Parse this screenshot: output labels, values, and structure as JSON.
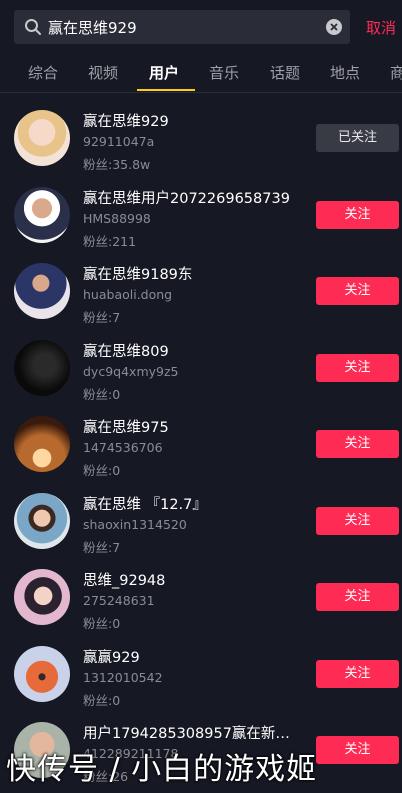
{
  "search": {
    "query": "赢在思维929",
    "cancel_label": "取消"
  },
  "tabs": [
    {
      "label": "综合"
    },
    {
      "label": "视频"
    },
    {
      "label": "用户"
    },
    {
      "label": "音乐"
    },
    {
      "label": "话题"
    },
    {
      "label": "地点"
    },
    {
      "label": "商"
    }
  ],
  "active_tab": "用户",
  "users": [
    {
      "name": "赢在思维929",
      "id": "92911047a",
      "fans": "粉丝:35.8w",
      "button": "已关注"
    },
    {
      "name": "赢在思维用户2072269658739",
      "id": "HMS88998",
      "fans": "粉丝:211",
      "button": "关注"
    },
    {
      "name": "赢在思维9189东",
      "id": "huabaoli.dong",
      "fans": "粉丝:7",
      "button": "关注"
    },
    {
      "name": "赢在思维809",
      "id": "dyc9q4xmy9z5",
      "fans": "粉丝:0",
      "button": "关注"
    },
    {
      "name": "赢在思维975",
      "id": "1474536706",
      "fans": "粉丝:0",
      "button": "关注"
    },
    {
      "name": "赢在思维 『12.7』",
      "id": "shaoxin1314520",
      "fans": "粉丝:7",
      "button": "关注"
    },
    {
      "name": "思维_92948",
      "id": "275248631",
      "fans": "粉丝:0",
      "button": "关注"
    },
    {
      "name": "赢赢929",
      "id": "1312010542",
      "fans": "粉丝:0",
      "button": "关注"
    },
    {
      "name": "用户1794285308957赢在新…",
      "id": "412289211178",
      "fans": "粉丝:26",
      "button": "关注"
    }
  ],
  "watermark": "快传号 / 小白的游戏姬",
  "colors": {
    "background": "#161823",
    "accent": "#fe2c55",
    "tab_indicator": "#face15"
  }
}
